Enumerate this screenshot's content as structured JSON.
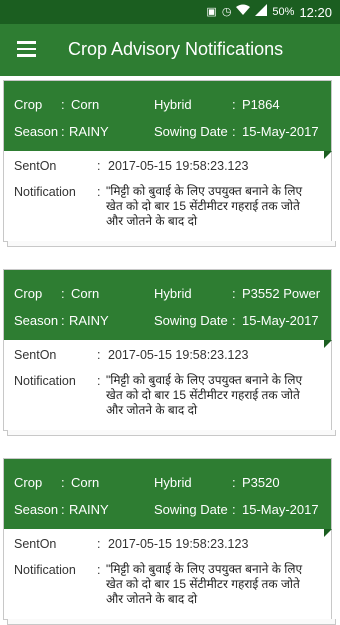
{
  "status": {
    "battery": "50%",
    "time": "12:20"
  },
  "header": {
    "title": "Crop Advisory Notifications"
  },
  "labels": {
    "crop": "Crop",
    "hybrid": "Hybrid",
    "season": "Season",
    "sowing_date": "Sowing Date",
    "sent_on": "SentOn",
    "notification": "Notification",
    "colon": ":"
  },
  "cards": [
    {
      "crop": "Corn",
      "hybrid": "P1864",
      "season": "RAINY",
      "sowing_date": "15-May-2017",
      "sent_on": "2017-05-15 19:58:23.123",
      "notification": "\"मिट्टी को बुवाई के लिए उपयुक्त बनाने के लिए खेत को दो बार 15 सेंटीमीटर गहराई तक जोते और जोतने के बाद दो"
    },
    {
      "crop": "Corn",
      "hybrid": "P3552 Power",
      "season": "RAINY",
      "sowing_date": "15-May-2017",
      "sent_on": "2017-05-15 19:58:23.123",
      "notification": "\"मिट्टी को बुवाई के लिए उपयुक्त बनाने के लिए खेत को दो बार 15 सेंटीमीटर गहराई तक जोते और जोतने के बाद दो"
    },
    {
      "crop": "Corn",
      "hybrid": "P3520",
      "season": "RAINY",
      "sowing_date": "15-May-2017",
      "sent_on": "2017-05-15 19:58:23.123",
      "notification": "\"मिट्टी को बुवाई के लिए उपयुक्त बनाने के लिए खेत को दो बार 15 सेंटीमीटर गहराई तक जोते और जोतने के बाद दो"
    }
  ]
}
